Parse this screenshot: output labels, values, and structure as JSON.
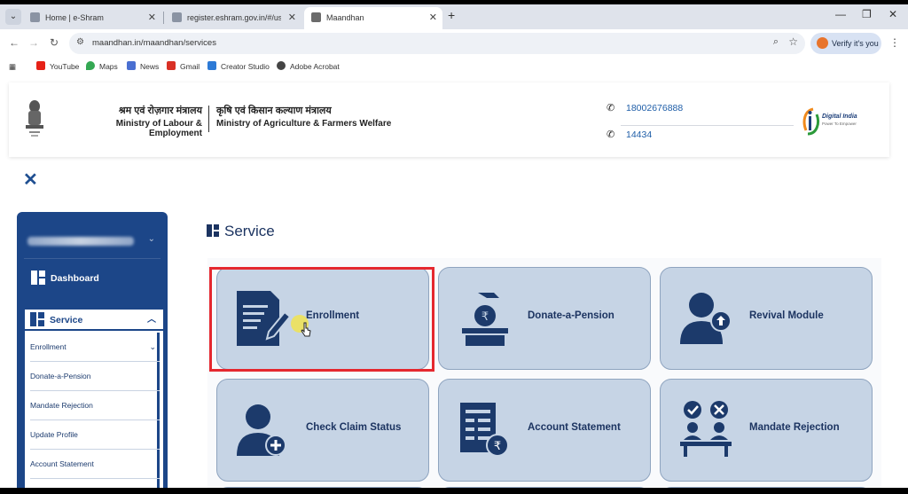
{
  "browser": {
    "tabs": [
      {
        "title": "Home | e-Shram",
        "active": false
      },
      {
        "title": "register.eshram.gov.in/#/user/s",
        "active": false
      },
      {
        "title": "Maandhan",
        "active": true
      }
    ],
    "url": "maandhan.in/maandhan/services",
    "profile_label": "Verify it's you",
    "bookmarks": [
      {
        "label": "YouTube",
        "icon": "youtube-icon",
        "color": "#e62117"
      },
      {
        "label": "Maps",
        "icon": "maps-icon",
        "color": "#34a853"
      },
      {
        "label": "News",
        "icon": "news-icon",
        "color": "#4a6fd1"
      },
      {
        "label": "Gmail",
        "icon": "gmail-icon",
        "color": "#d93025"
      },
      {
        "label": "Creator Studio",
        "icon": "creator-studio-icon",
        "color": "#2d7ad6"
      },
      {
        "label": "Adobe Acrobat",
        "icon": "adobe-acrobat-icon",
        "color": "#444444"
      }
    ]
  },
  "header": {
    "ministry1_hi": "श्रम एवं रोज़गार मंत्रालय",
    "ministry1_en": "Ministry of Labour & Employment",
    "ministry2_hi": "कृषि एवं किसान कल्याण मंत्रालय",
    "ministry2_en": "Ministry of Agriculture & Farmers Welfare",
    "phone1": "18002676888",
    "phone2": "14434",
    "logo_title": "Digital India",
    "logo_tagline": "Power To Empower"
  },
  "sidebar": {
    "dashboard": "Dashboard",
    "service": "Service",
    "items": [
      {
        "label": "Enrollment",
        "expandable": true
      },
      {
        "label": "Donate-a-Pension",
        "expandable": false
      },
      {
        "label": "Mandate Rejection",
        "expandable": false
      },
      {
        "label": "Update Profile",
        "expandable": false
      },
      {
        "label": "Account Statement",
        "expandable": false
      }
    ]
  },
  "main": {
    "title": "Service",
    "cards": [
      {
        "label": "Enrollment",
        "icon": "enrollment-form-icon"
      },
      {
        "label": "Donate-a-Pension",
        "icon": "donate-pension-icon"
      },
      {
        "label": "Revival Module",
        "icon": "revival-user-icon"
      },
      {
        "label": "Check Claim Status",
        "icon": "check-claim-user-icon"
      },
      {
        "label": "Account Statement",
        "icon": "account-statement-icon"
      },
      {
        "label": "Mandate Rejection",
        "icon": "mandate-rejection-icon"
      }
    ]
  },
  "colors": {
    "brand_navy": "#1c4688",
    "card_bg": "#c6d4e5",
    "highlight_red": "#e5282f",
    "link_blue": "#1f5ea8"
  }
}
